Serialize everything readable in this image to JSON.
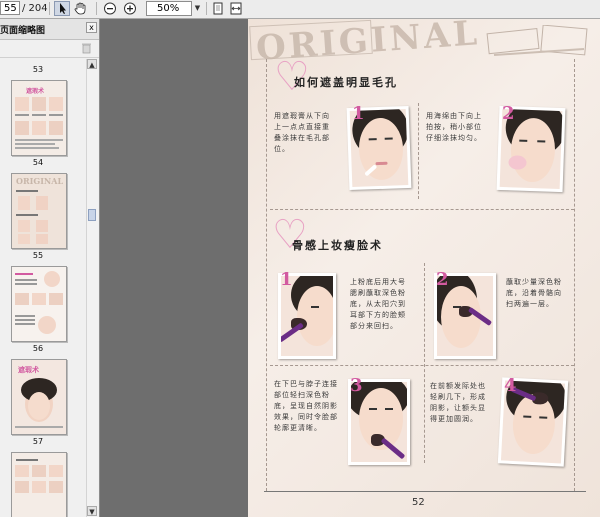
{
  "toolbar": {
    "page_current": "55",
    "page_total": "/ 204",
    "zoom": "50%",
    "icons": [
      "select-arrow-icon",
      "hand-icon",
      "zoom-out-icon",
      "zoom-in-icon",
      "fit-page-icon",
      "fit-width-icon"
    ]
  },
  "panel": {
    "title": "页面缩略图",
    "close_label": "x",
    "thumbnails": [
      {
        "label": "53"
      },
      {
        "label": "54"
      },
      {
        "label": "55"
      },
      {
        "label": "56"
      },
      {
        "label": "57"
      }
    ],
    "selected_page": "55"
  },
  "page": {
    "header_text": "ORIGINAL",
    "section1": {
      "title": "如何遮盖明显毛孔",
      "steps": [
        {
          "number": "1",
          "text": "用遮瑕膏从下向上一点点直接重叠涂抹在毛孔部位。"
        },
        {
          "number": "2",
          "text": "用海绵由下向上拍按，稍小部位仔细涂抹均匀。"
        }
      ]
    },
    "section2": {
      "title": "骨感上妆瘦脸术",
      "steps": [
        {
          "number": "1",
          "text": "上粉底后用大号腮刷蘸取深色粉底，从太阳穴到耳部下方的脸颊部分来回扫。"
        },
        {
          "number": "2",
          "text": "蘸取少量深色粉底，沿着骨骼向扫两遍一层。"
        },
        {
          "number": "3",
          "text": "在下巴与脖子连接部位轻扫深色粉底，呈现自然阴影效果，同时令脸部轮廓更清晰。"
        },
        {
          "number": "4",
          "text": "在前额发际处也轻刷几下，形成阴影，让额头显得更加圆润。"
        }
      ]
    },
    "page_number": "52"
  },
  "colors": {
    "toolbar_bg": "#ececec",
    "workspace_bg": "#6e6e6e",
    "accent_pink": "#d25aa0",
    "brush_purple": "#6b2d86",
    "selected_border": "#4a78c2"
  }
}
